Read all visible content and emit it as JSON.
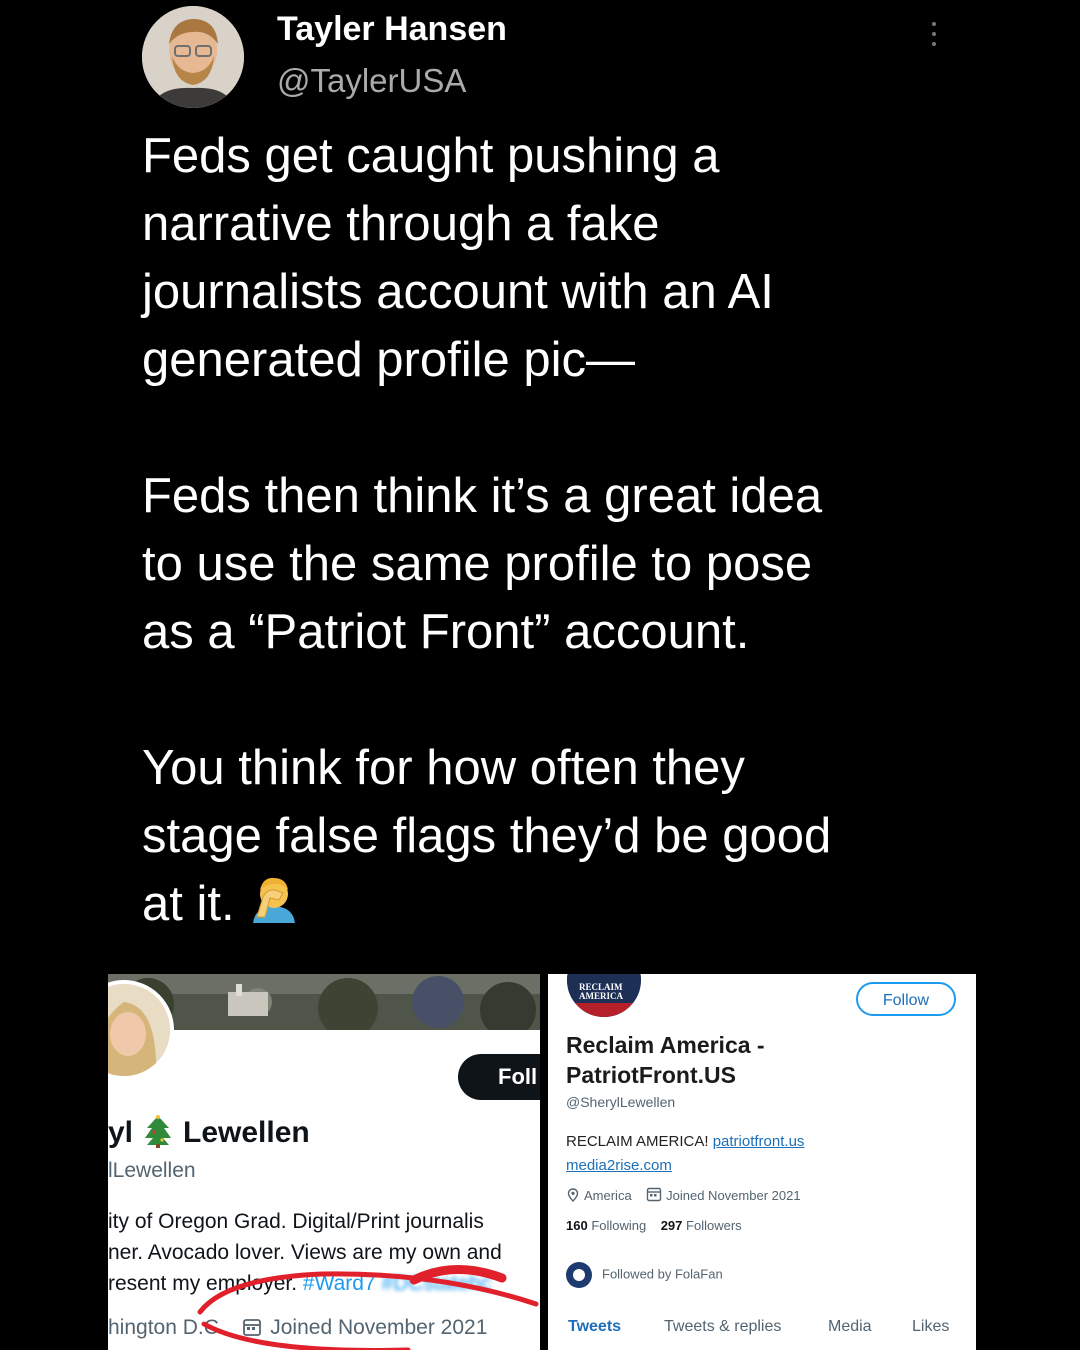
{
  "author": {
    "name": "Tayler Hansen",
    "handle": "@TaylerUSA"
  },
  "tweet": {
    "paragraph1": [
      "Feds get caught pushing a",
      "narrative through a fake",
      "journalists account with an AI",
      "generated profile pic—"
    ],
    "paragraph2": [
      "Feds then think it’s a great idea",
      "to use the same profile to pose",
      "as a “Patriot Front” account."
    ],
    "paragraph3": [
      "You think for how often they",
      "stage false flags they’d be good",
      "at it."
    ],
    "emoji": "facepalm-emoji"
  },
  "left_profile": {
    "follow_label": "Foll",
    "name_part1": "yl",
    "name_part2": "Lewellen",
    "handle": "lLewellen",
    "bio_line1": "ity of Oregon Grad. Digital/Print journalis",
    "bio_line2": "ner. Avocado lover. Views are my own and",
    "bio_line3_prefix": "resent my employer. ",
    "bio_line3_tag": "#Ward7",
    "bio_line3_blur": "#DCstatehc",
    "location": "hington D.C.",
    "joined": "Joined November 2021"
  },
  "right_profile": {
    "logo_text": "RECLAIM AMERICA",
    "follow_label": "Follow",
    "name_line1": "Reclaim America -",
    "name_line2": "PatriotFront.US",
    "handle": "@SherylLewellen",
    "bio_prefix": "RECLAIM AMERICA! ",
    "bio_link1": "patriotfront.us",
    "bio_link2": "media2rise.com",
    "location": "America",
    "joined": "Joined November 2021",
    "following_count": "160",
    "following_label": "Following",
    "followers_count": "297",
    "followers_label": "Followers",
    "followed_by": "Followed by FolaFan",
    "tabs": [
      "Tweets",
      "Tweets & replies",
      "Media",
      "Likes"
    ]
  },
  "colors": {
    "background": "#000000",
    "link_blue": "#1d9bf0",
    "highlight_red": "#e0202a"
  }
}
